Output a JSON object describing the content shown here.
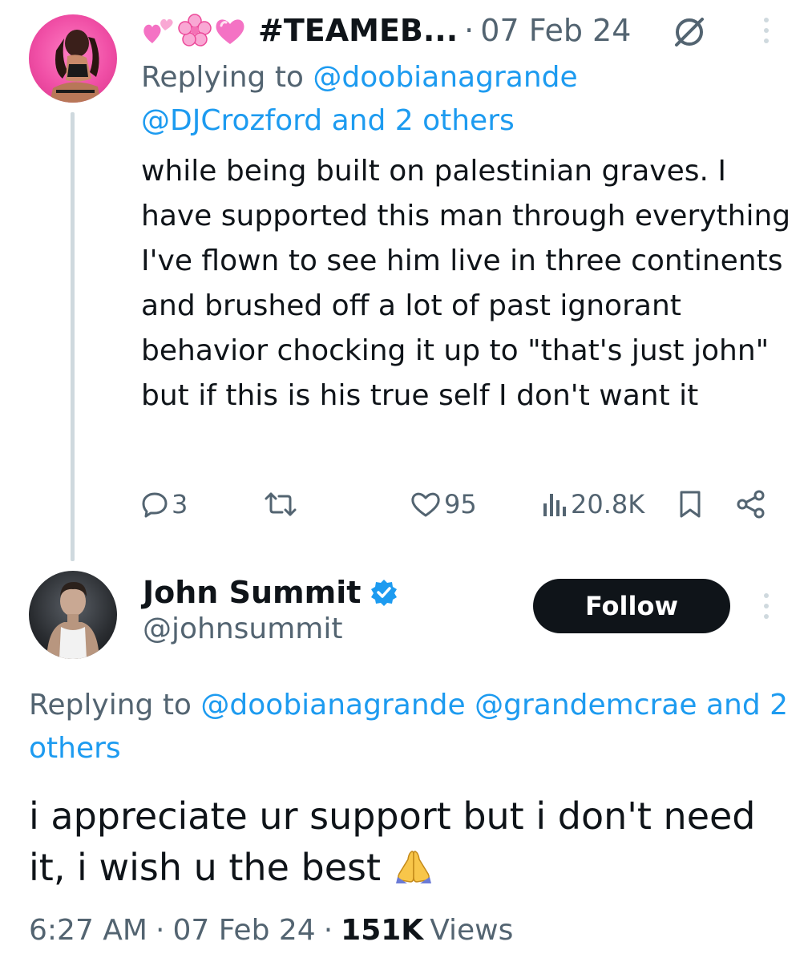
{
  "parent_tweet": {
    "display_name": "#TEAMEB...",
    "name_emojis": [
      "hearts-emoji",
      "cherry-blossom-emoji",
      "sparkling-heart-emoji"
    ],
    "separator": "·",
    "date": "07 Feb 24",
    "replying_label": "Replying to",
    "replying_user1": "@doobianagrande",
    "replying_user2": "@DJCrozford",
    "replying_others": "and 2 others",
    "body": "while being built on palestinian graves. I have supported this man through everything I've flown to see him live in three continents and brushed off a lot of past ignorant behavior chocking it up to \"that's just john\" but if this is his true self I don't want it",
    "actions": {
      "reply_count": "3",
      "repost_count": "",
      "like_count": "95",
      "view_count": "20.8K"
    },
    "icons": [
      "grok-icon",
      "more-icon",
      "reply-icon",
      "repost-icon",
      "like-icon",
      "views-icon",
      "bookmark-icon",
      "share-icon"
    ]
  },
  "reply_tweet": {
    "display_name": "John Summit",
    "verified": true,
    "handle": "@johnsummit",
    "follow_label": "Follow",
    "replying_label": "Replying to",
    "replying_user1": "@doobianagrande",
    "replying_user2": "@grandemcrae",
    "replying_others_line1": "and 2",
    "replying_others_line2": "others",
    "body": "i appreciate ur support but i don't need it, i wish u the best",
    "body_emoji": "folded-hands-emoji",
    "time": "6:27 AM",
    "separator": "·",
    "date": "07 Feb 24",
    "views_count": "151K",
    "views_label": "Views"
  },
  "colors": {
    "text_primary": "#0f1419",
    "text_secondary": "#536471",
    "link": "#1d9bf0",
    "verified": "#1d9bf0",
    "thread_line": "#cfd9de",
    "follow_bg": "#0f1419"
  }
}
